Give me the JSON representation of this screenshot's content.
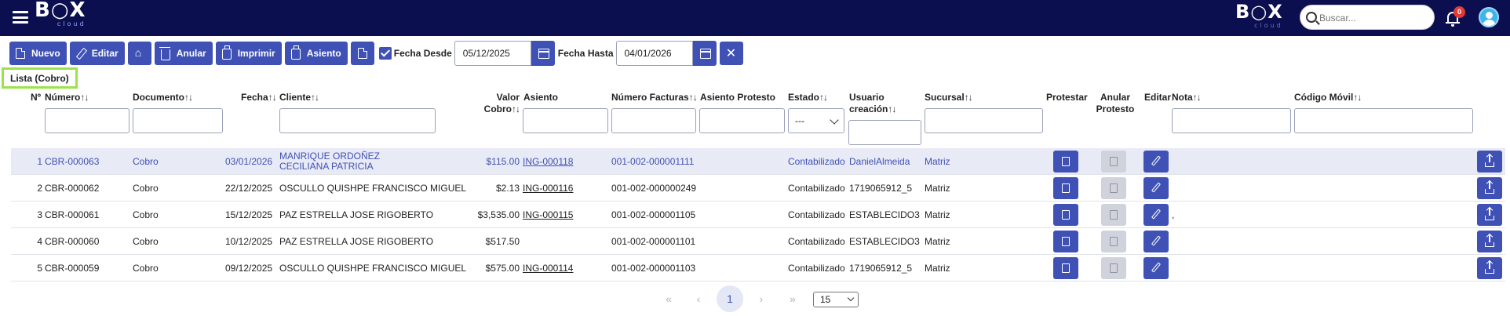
{
  "app": {
    "logo_left": "B○X",
    "logo_left_sub": "cloud",
    "logo_right": "B○X",
    "logo_right_sub": "cloud",
    "search_placeholder": "Buscar...",
    "notifications": "0"
  },
  "toolbar": {
    "nuevo": "Nuevo",
    "editar": "Editar",
    "anular": "Anular",
    "imprimir": "Imprimir",
    "asiento": "Asiento",
    "fecha_desde_label": "Fecha Desde",
    "fecha_desde": "05/12/2025",
    "fecha_hasta_label": "Fecha Hasta",
    "fecha_hasta": "04/01/2026",
    "clear": "✕"
  },
  "list_title": "Lista (Cobro)",
  "columns": {
    "no": "Nº",
    "numero": "Número",
    "documento": "Documento",
    "fecha": "Fecha",
    "cliente": "Cliente",
    "valor_cobro_1": "Valor",
    "valor_cobro_2": "Cobro",
    "asiento": "Asiento",
    "numero_facturas": "Número Facturas",
    "asiento_protesto": "Asiento Protesto",
    "estado": "Estado",
    "usuario_creacion_1": "Usuario",
    "usuario_creacion_2": "creación",
    "sucursal": "Sucursal",
    "protestar": "Protestar",
    "anular_protesto_1": "Anular",
    "anular_protesto_2": "Protesto",
    "editar": "Editar",
    "nota": "Nota",
    "codigo_movil": "Código Móvil",
    "sort_glyph": "↑↓",
    "estado_filter": "---"
  },
  "rows": [
    {
      "no": "1",
      "numero": "CBR-000063",
      "documento": "Cobro",
      "fecha": "03/01/2026",
      "cliente": "MANRIQUE ORDOÑEZ CECILIANA PATRICIA",
      "valor": "$115.00",
      "asiento": "ING-000118",
      "facturas": "001-002-000001111",
      "estado": "Contabilizado",
      "usuario": "DanielAlmeida",
      "sucursal": "Matriz",
      "nota": ""
    },
    {
      "no": "2",
      "numero": "CBR-000062",
      "documento": "Cobro",
      "fecha": "22/12/2025",
      "cliente": "OSCULLO QUISHPE FRANCISCO MIGUEL",
      "valor": "$2.13",
      "asiento": "ING-000116",
      "facturas": "001-002-000000249",
      "estado": "Contabilizado",
      "usuario": "1719065912_5",
      "sucursal": "Matriz",
      "nota": ""
    },
    {
      "no": "3",
      "numero": "CBR-000061",
      "documento": "Cobro",
      "fecha": "15/12/2025",
      "cliente": "PAZ ESTRELLA JOSE RIGOBERTO",
      "valor": "$3,535.00",
      "asiento": "ING-000115",
      "facturas": "001-002-000001105",
      "estado": "Contabilizado",
      "usuario": "ESTABLECIDO3",
      "sucursal": "Matriz",
      "nota": ","
    },
    {
      "no": "4",
      "numero": "CBR-000060",
      "documento": "Cobro",
      "fecha": "10/12/2025",
      "cliente": "PAZ ESTRELLA JOSE RIGOBERTO",
      "valor": "$517.50",
      "asiento": "",
      "facturas": "001-002-000001101",
      "estado": "Contabilizado",
      "usuario": "ESTABLECIDO3",
      "sucursal": "Matriz",
      "nota": ""
    },
    {
      "no": "5",
      "numero": "CBR-000059",
      "documento": "Cobro",
      "fecha": "09/12/2025",
      "cliente": "OSCULLO QUISHPE FRANCISCO MIGUEL",
      "valor": "$575.00",
      "asiento": "ING-000114",
      "facturas": "001-002-000001103",
      "estado": "Contabilizado",
      "usuario": "1719065912_5",
      "sucursal": "Matriz",
      "nota": ""
    }
  ],
  "pagination": {
    "first": "«",
    "prev": "‹",
    "current": "1",
    "next": "›",
    "last": "»",
    "page_size": "15"
  },
  "colors": {
    "topbar": "#0b0f4f",
    "primary": "#3f51b5",
    "highlight": "#9be34a",
    "selected_row": "#e8eaf6"
  }
}
